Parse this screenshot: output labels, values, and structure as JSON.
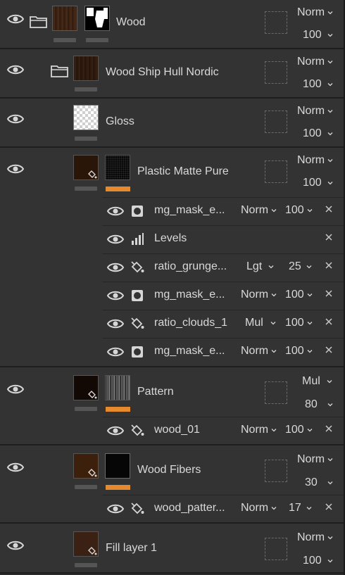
{
  "layers": [
    {
      "name": "Wood",
      "blend": "Norm",
      "opacity": "100"
    },
    {
      "name": "Wood Ship Hull Nordic",
      "blend": "Norm",
      "opacity": "100"
    },
    {
      "name": "Gloss",
      "blend": "Norm",
      "opacity": "100"
    },
    {
      "name": "Plastic Matte Pure",
      "blend": "Norm",
      "opacity": "100"
    },
    {
      "name": "Pattern",
      "blend": "Mul",
      "opacity": "80"
    },
    {
      "name": "Wood Fibers",
      "blend": "Norm",
      "opacity": "30"
    },
    {
      "name": "Fill layer 1",
      "blend": "Norm",
      "opacity": "100"
    }
  ],
  "plastic_effects": [
    {
      "name": "mg_mask_e...",
      "icon": "circle-mask-icon",
      "blend": "Norm",
      "opacity": "100"
    },
    {
      "name": "Levels",
      "icon": "levels-icon",
      "blend": "",
      "opacity": ""
    },
    {
      "name": "ratio_grunge...",
      "icon": "fill-bucket-icon",
      "blend": "Lgt",
      "opacity": "25"
    },
    {
      "name": "mg_mask_e...",
      "icon": "circle-mask-icon",
      "blend": "Norm",
      "opacity": "100"
    },
    {
      "name": "ratio_clouds_1",
      "icon": "fill-bucket-icon",
      "blend": "Mul",
      "opacity": "100"
    },
    {
      "name": "mg_mask_e...",
      "icon": "circle-mask-icon",
      "blend": "Norm",
      "opacity": "100"
    }
  ],
  "pattern_effects": [
    {
      "name": "wood_01",
      "icon": "fill-bucket-icon",
      "blend": "Norm",
      "opacity": "100"
    }
  ],
  "fibers_effects": [
    {
      "name": "wood_patter...",
      "icon": "fill-bucket-icon",
      "blend": "Norm",
      "opacity": "17"
    }
  ],
  "colors": {
    "panel": "#333333",
    "accent": "#e68a2e",
    "text": "#d9d9d9",
    "divider": "#1e1e1e"
  }
}
